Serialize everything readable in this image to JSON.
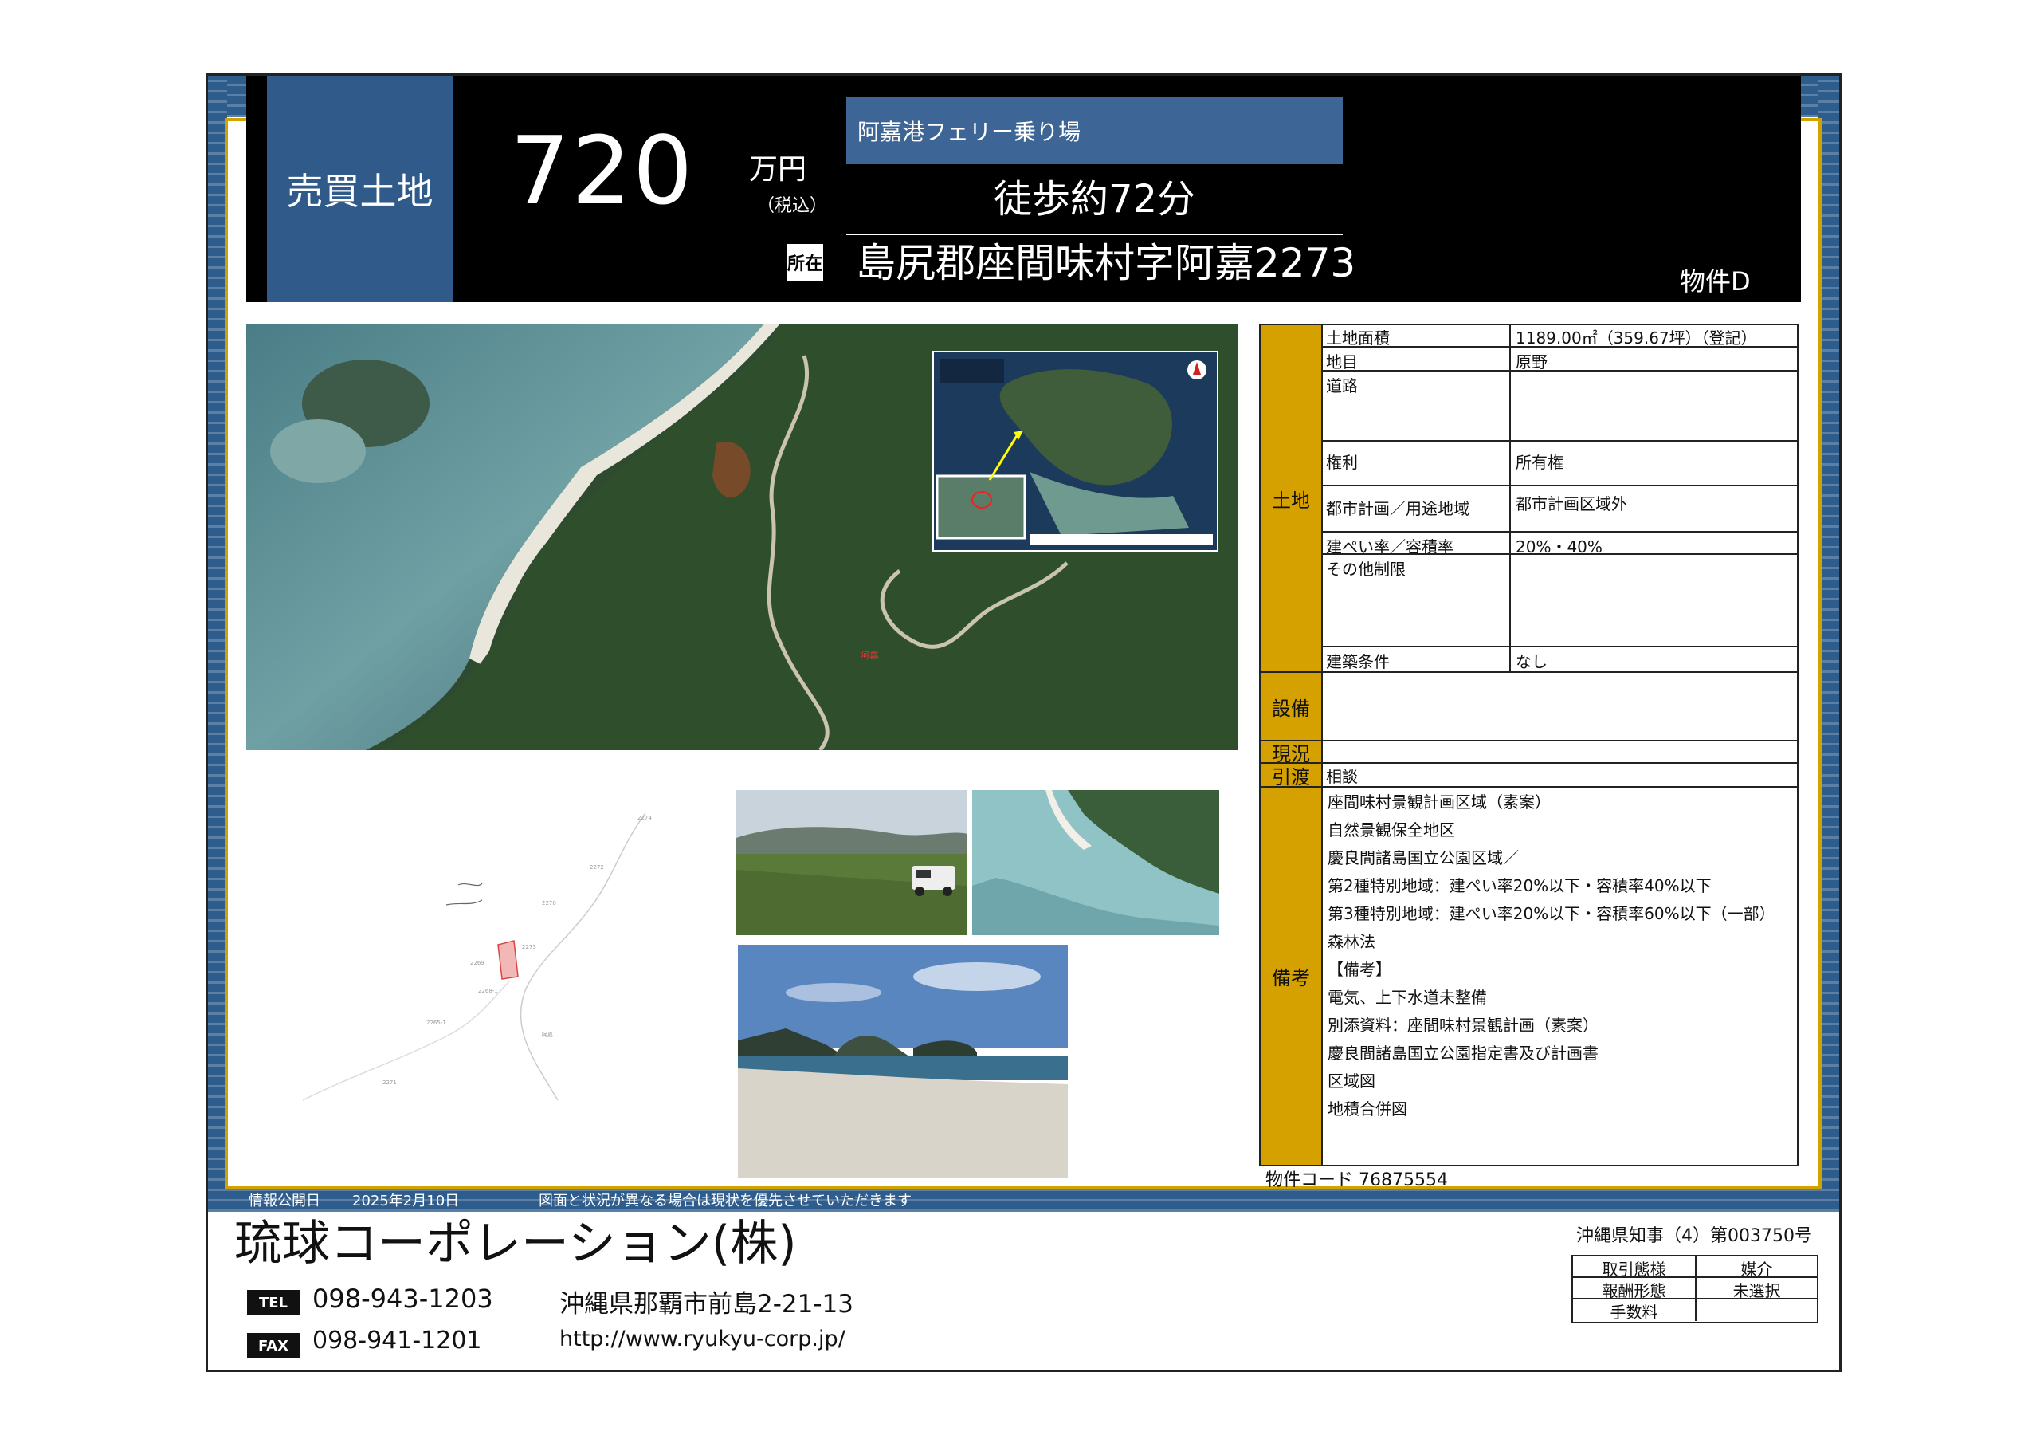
{
  "header": {
    "type": "売買土地",
    "price": "720",
    "unit": "万円",
    "tax": "（税込）",
    "station": "阿嘉港フェリー乗り場",
    "walk": "徒歩約72分",
    "address_icon": "所在",
    "address": "島尻郡座間味村字阿嘉2273",
    "property_id": "物件D"
  },
  "table": {
    "land_label": "土地",
    "equipment_label": "設備",
    "status_label": "現況",
    "delivery_label": "引渡",
    "notes_label": "備考",
    "rows": [
      {
        "label": "土地面積",
        "value": "1189.00㎡（359.67坪）（登記）"
      },
      {
        "label": "地目",
        "value": "原野"
      },
      {
        "label": "道路",
        "value": ""
      },
      {
        "label": "権利",
        "value": "所有権"
      },
      {
        "label": "都市計画／用途地域",
        "value": "都市計画区域外"
      },
      {
        "label": "建ぺい率／容積率",
        "value": "20%・40%"
      },
      {
        "label": "その他制限",
        "value": ""
      },
      {
        "label": "建築条件",
        "value": "なし"
      }
    ],
    "equipment_value": "",
    "status_value": "",
    "delivery_value": "相談",
    "notes": [
      "座間味村景観計画区域（素案）",
      "自然景観保全地区",
      "慶良間諸島国立公園区域／",
      "第2種特別地域：建ぺい率20%以下・容積率40%以下",
      "第3種特別地域：建ぺい率20%以下・容積率60%以下（一部）",
      "森林法",
      "【備考】",
      "電気、上下水道未整備",
      "別添資料：座間味村景観計画（素案）",
      "慶良間諸島国立公園指定書及び計画書",
      "区域図",
      "地積合併図"
    ],
    "code": "物件コード 76875554"
  },
  "info_bar": {
    "label": "情報公開日",
    "date": "2025年2月10日",
    "note": "図面と状況が異なる場合は現状を優先させていただきます"
  },
  "footer": {
    "company": "琉球コーポレーション(株)",
    "license": "沖縄県知事（4）第003750号",
    "tel_badge": "TEL",
    "tel": "098-943-1203",
    "fax_badge": "FAX",
    "fax": "098-941-1201",
    "address": "沖縄県那覇市前島2-21-13",
    "url": "http://www.ryukyu-corp.jp/",
    "deal": [
      {
        "key": "取引態様",
        "value": "媒介"
      },
      {
        "key": "報酬形態",
        "value": "未選択"
      },
      {
        "key": "手数料",
        "value": ""
      }
    ]
  },
  "colors": {
    "accent_blue": "#2f5a8a",
    "gold": "#d4a100",
    "header_bg": "#000000"
  }
}
